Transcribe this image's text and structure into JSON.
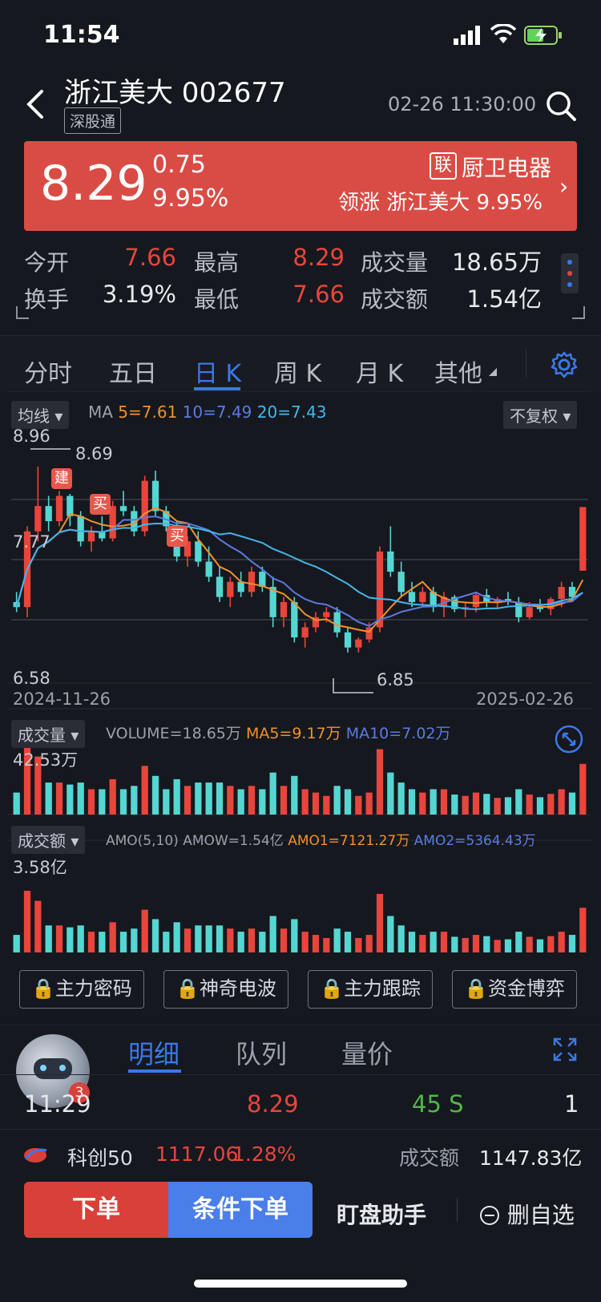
{
  "status": {
    "time": "11:54"
  },
  "header": {
    "title": "浙江美大 002677",
    "tag": "深股通",
    "datetime": "02-26 11:30:00"
  },
  "quote": {
    "price": "8.29",
    "change": "0.75",
    "change_pct": "9.95%",
    "sector_tag": "联",
    "sector": "厨卫电器",
    "leader": "领涨  浙江美大 9.95%"
  },
  "stats": [
    {
      "label": "今开",
      "value": "7.66"
    },
    {
      "label": "最高",
      "value": "8.29"
    },
    {
      "label": "成交量",
      "value": "18.65万"
    },
    {
      "label": "换手",
      "value": "3.19%"
    },
    {
      "label": "最低",
      "value": "7.66"
    },
    {
      "label": "成交额",
      "value": "1.54亿"
    }
  ],
  "period_tabs": [
    "分时",
    "五日",
    "日 K",
    "周 K",
    "月 K",
    "其他"
  ],
  "chart": {
    "ma_chip": "均线",
    "ma_text": "MA",
    "ma5": "5=7.61",
    "ma10": "10=7.49",
    "ma20": "20=7.43",
    "adjust": "不复权",
    "y_top": "8.96",
    "y_mid": "7.77",
    "y_bottom": "6.58",
    "high_label": "8.69",
    "low_label": "6.85",
    "mark_build": "建",
    "mark_buy1": "买",
    "mark_buy2": "买",
    "date_start": "2024-11-26",
    "date_end": "2025-02-26",
    "vol_chip": "成交量",
    "vol_text": "VOLUME=18.65万",
    "vol_ma5": "MA5=9.17万",
    "vol_ma10": "MA10=7.02万",
    "vol_max": "42.53万",
    "amo_chip": "成交额",
    "amo_text": "AMO(5,10)  AMOW=1.54亿",
    "amo1": "AMO1=7121.27万",
    "amo2": "AMO2=5364.43万",
    "amo_max": "3.58亿"
  },
  "chart_data": {
    "type": "candlestick",
    "x_range": [
      "2024-11-26",
      "2025-02-26"
    ],
    "ylim": [
      6.58,
      8.96
    ],
    "annotations": {
      "high": 8.69,
      "low": 6.85
    },
    "ma": {
      "ma5": 7.61,
      "ma10": 7.49,
      "ma20": 7.43
    },
    "candles": [
      [
        7.35,
        7.45,
        7.25,
        7.3
      ],
      [
        7.3,
        8.1,
        7.2,
        8.05
      ],
      [
        8.05,
        8.69,
        7.95,
        8.3
      ],
      [
        8.3,
        8.4,
        8.05,
        8.15
      ],
      [
        8.15,
        8.45,
        8.1,
        8.4
      ],
      [
        8.4,
        8.42,
        8.1,
        8.2
      ],
      [
        8.2,
        8.25,
        7.9,
        7.95
      ],
      [
        7.95,
        8.1,
        7.85,
        8.05
      ],
      [
        8.05,
        8.2,
        7.95,
        7.98
      ],
      [
        7.98,
        8.35,
        7.95,
        8.3
      ],
      [
        8.3,
        8.45,
        8.2,
        8.25
      ],
      [
        8.25,
        8.3,
        8.0,
        8.05
      ],
      [
        8.05,
        8.6,
        8.0,
        8.55
      ],
      [
        8.55,
        8.65,
        8.2,
        8.25
      ],
      [
        8.25,
        8.3,
        8.05,
        8.1
      ],
      [
        8.1,
        8.15,
        7.75,
        7.8
      ],
      [
        7.8,
        8.0,
        7.7,
        7.95
      ],
      [
        7.95,
        8.05,
        7.7,
        7.75
      ],
      [
        7.75,
        7.9,
        7.55,
        7.6
      ],
      [
        7.6,
        7.7,
        7.35,
        7.4
      ],
      [
        7.4,
        7.6,
        7.3,
        7.55
      ],
      [
        7.55,
        7.65,
        7.4,
        7.45
      ],
      [
        7.45,
        7.7,
        7.4,
        7.65
      ],
      [
        7.65,
        7.7,
        7.45,
        7.5
      ],
      [
        7.5,
        7.6,
        7.1,
        7.2
      ],
      [
        7.2,
        7.4,
        7.1,
        7.35
      ],
      [
        7.35,
        7.4,
        6.95,
        7.0
      ],
      [
        7.0,
        7.15,
        6.9,
        7.1
      ],
      [
        7.1,
        7.25,
        7.05,
        7.2
      ],
      [
        7.2,
        7.3,
        7.15,
        7.25
      ],
      [
        7.25,
        7.3,
        7.0,
        7.05
      ],
      [
        7.05,
        7.1,
        6.85,
        6.9
      ],
      [
        6.9,
        7.0,
        6.85,
        6.98
      ],
      [
        6.98,
        7.15,
        6.95,
        7.1
      ],
      [
        7.1,
        7.9,
        7.05,
        7.85
      ],
      [
        7.85,
        8.1,
        7.6,
        7.65
      ],
      [
        7.65,
        7.75,
        7.4,
        7.45
      ],
      [
        7.45,
        7.55,
        7.3,
        7.35
      ],
      [
        7.35,
        7.5,
        7.3,
        7.45
      ],
      [
        7.45,
        7.5,
        7.25,
        7.3
      ],
      [
        7.3,
        7.45,
        7.2,
        7.4
      ],
      [
        7.4,
        7.42,
        7.25,
        7.28
      ],
      [
        7.28,
        7.35,
        7.2,
        7.3
      ],
      [
        7.3,
        7.45,
        7.25,
        7.42
      ],
      [
        7.42,
        7.48,
        7.3,
        7.35
      ],
      [
        7.35,
        7.4,
        7.28,
        7.38
      ],
      [
        7.38,
        7.45,
        7.32,
        7.35
      ],
      [
        7.35,
        7.4,
        7.15,
        7.2
      ],
      [
        7.2,
        7.35,
        7.18,
        7.3
      ],
      [
        7.3,
        7.38,
        7.25,
        7.28
      ],
      [
        7.28,
        7.4,
        7.22,
        7.38
      ],
      [
        7.38,
        7.55,
        7.3,
        7.5
      ],
      [
        7.5,
        7.55,
        7.35,
        7.4
      ],
      [
        7.66,
        8.29,
        7.66,
        8.29
      ]
    ]
  },
  "feature_buttons": [
    "主力密码",
    "神奇电波",
    "主力跟踪",
    "资金博弈"
  ],
  "detail_tabs": [
    "明细",
    "队列",
    "量价"
  ],
  "avatar_badge": "3",
  "trade_row": {
    "time": "11:29",
    "price": "8.29",
    "volume": "45 S",
    "count": "1"
  },
  "index": {
    "name": "科创50",
    "value": "1117.06",
    "pct": "1.28%",
    "turnover_label": "成交额",
    "turnover": "1147.83亿"
  },
  "bottom": {
    "order": "下单",
    "cond_order": "条件下单",
    "assistant": "盯盘助手",
    "remove": "删自选"
  }
}
